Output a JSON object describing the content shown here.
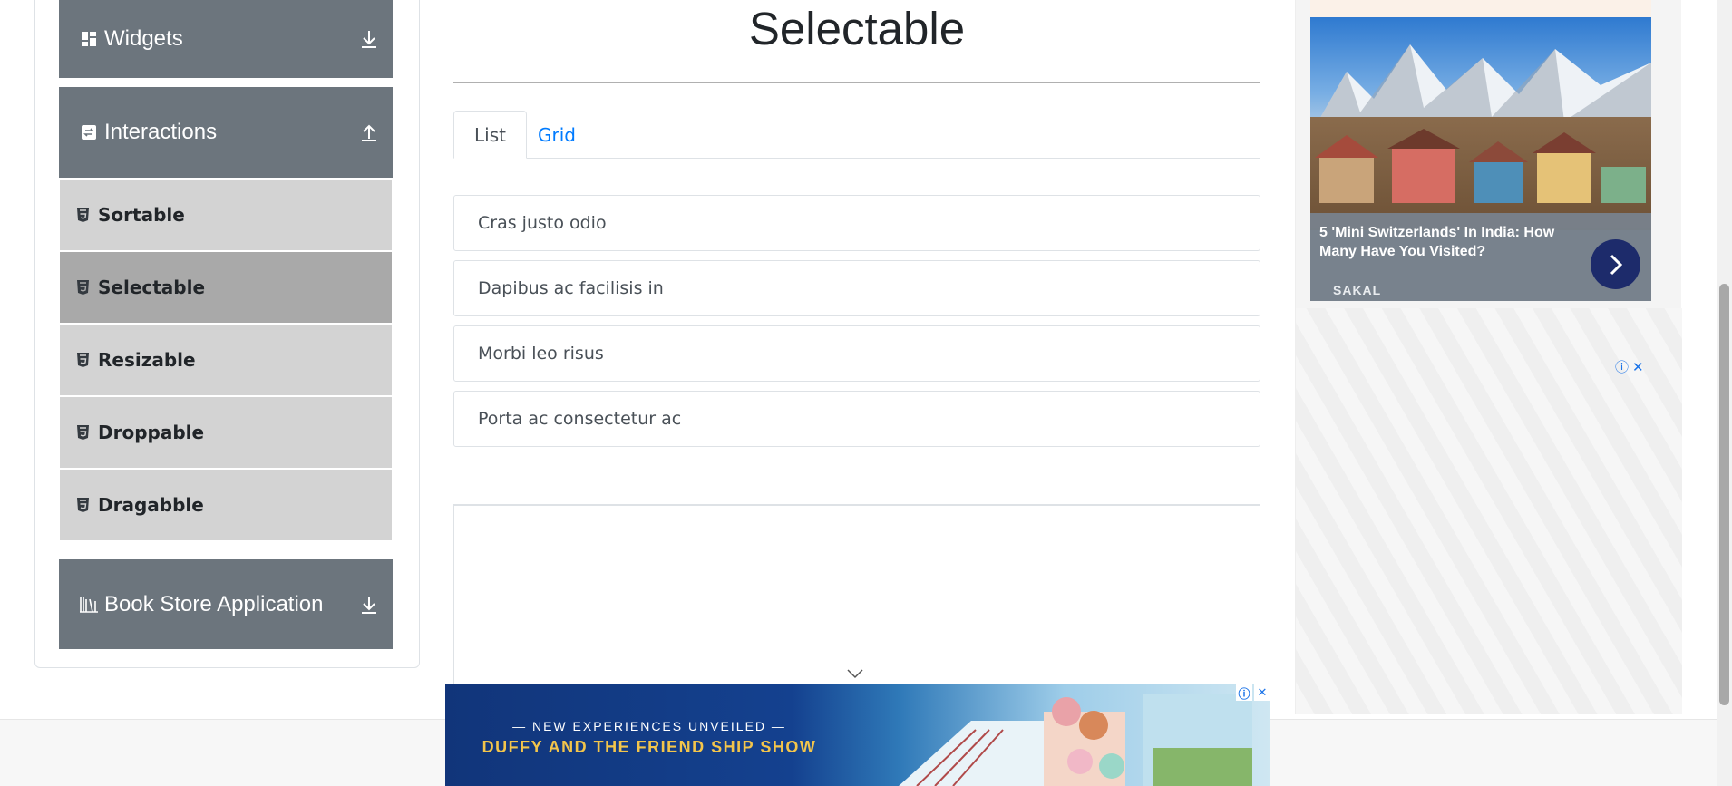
{
  "sidebar": {
    "groups": {
      "widgets": {
        "label": "Widgets",
        "icon": "widgets-icon",
        "toggle_icon": "download-arrow-icon"
      },
      "interactions": {
        "label": "Interactions",
        "icon": "interactions-icon",
        "toggle_icon": "upload-arrow-icon"
      },
      "book_store": {
        "label": "Book Store Application",
        "icon": "books-icon",
        "toggle_icon": "download-arrow-icon"
      }
    },
    "items": [
      {
        "label": "Sortable",
        "active": false
      },
      {
        "label": "Selectable",
        "active": true
      },
      {
        "label": "Resizable",
        "active": false
      },
      {
        "label": "Droppable",
        "active": false
      },
      {
        "label": "Dragabble",
        "active": false
      }
    ],
    "colors": {
      "header_bg": "#6c757d",
      "item_bg": "#d3d3d3",
      "item_active_bg": "#a9a9a9"
    }
  },
  "main": {
    "title": "Selectable",
    "tabs": [
      {
        "label": "List",
        "active": true
      },
      {
        "label": "Grid",
        "active": false
      }
    ],
    "list_items": [
      "Cras justo odio",
      "Dapibus ac facilisis in",
      "Morbi leo risus",
      "Porta ac consectetur ac"
    ],
    "link_color": "#007bff"
  },
  "ads": {
    "right_card": {
      "headline": "5 'Mini Switzerlands' In India: How Many Have You Visited?",
      "source": "SAKAL",
      "arrow_icon": "chevron-right-icon"
    },
    "bottom_banner": {
      "line1": "— NEW EXPERIENCES UNVEILED —",
      "line2": "DUFFY AND THE FRIEND SHIP SHOW"
    },
    "info_icon": "ⓘ",
    "close_icon": "✕"
  }
}
